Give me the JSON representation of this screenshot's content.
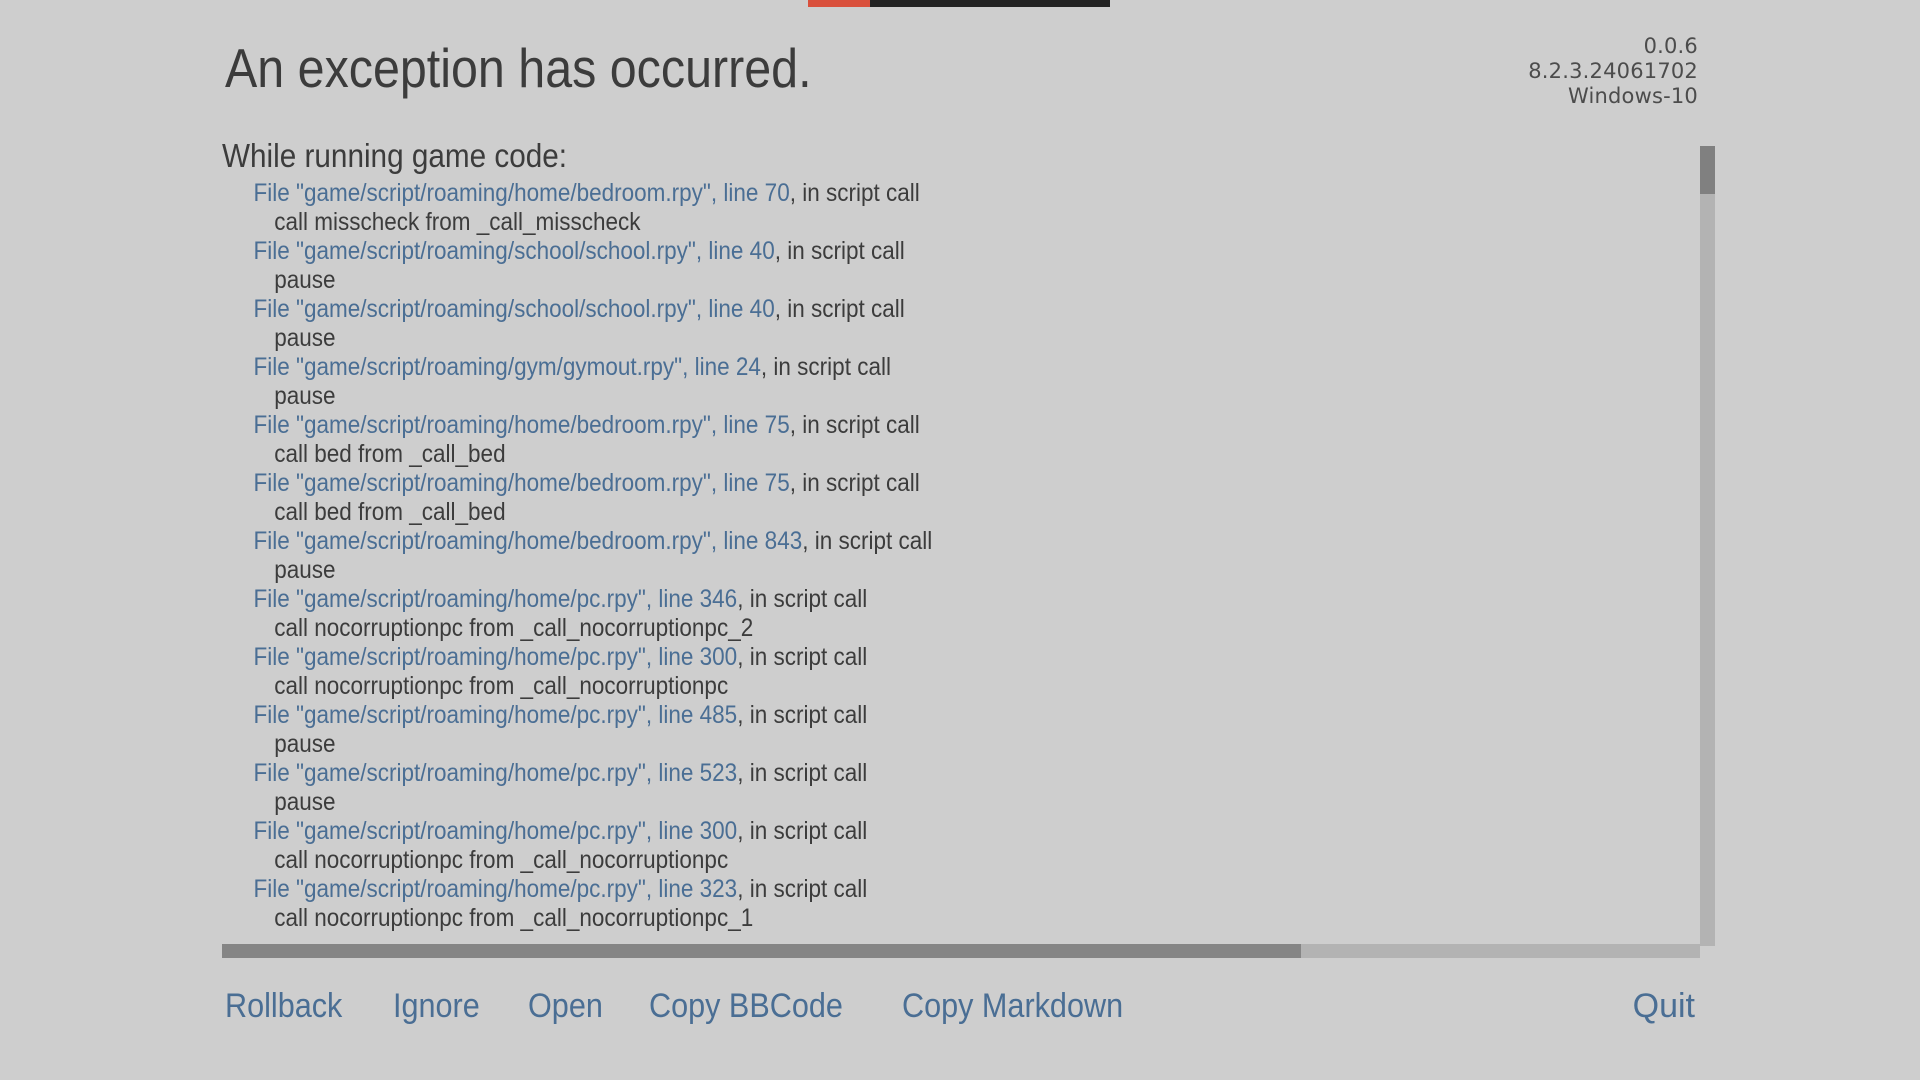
{
  "window": {
    "background_color": "#cecece",
    "link_color": "#4a6e94",
    "text_color": "#3c3c3c",
    "accent_color": "#d9503c"
  },
  "top_strip": {
    "segment_a_color": "#d9503c",
    "segment_b_color": "#232323"
  },
  "header": {
    "title": "An exception has occurred.",
    "version": {
      "game_version": "0.0.6",
      "engine_version": "8.2.3.24061702",
      "platform": "Windows-10"
    }
  },
  "traceback": {
    "heading": "While running game code:",
    "frames": [
      {
        "link": "File \"game/script/roaming/home/bedroom.rpy\", line 70",
        "suffix": ", in script call",
        "code": "call misscheck from _call_misscheck"
      },
      {
        "link": "File \"game/script/roaming/school/school.rpy\", line 40",
        "suffix": ", in script call",
        "code": "pause"
      },
      {
        "link": "File \"game/script/roaming/school/school.rpy\", line 40",
        "suffix": ", in script call",
        "code": "pause"
      },
      {
        "link": "File \"game/script/roaming/gym/gymout.rpy\", line 24",
        "suffix": ", in script call",
        "code": "pause"
      },
      {
        "link": "File \"game/script/roaming/home/bedroom.rpy\", line 75",
        "suffix": ", in script call",
        "code": "call bed from _call_bed"
      },
      {
        "link": "File \"game/script/roaming/home/bedroom.rpy\", line 75",
        "suffix": ", in script call",
        "code": "call bed from _call_bed"
      },
      {
        "link": "File \"game/script/roaming/home/bedroom.rpy\", line 843",
        "suffix": ", in script call",
        "code": "pause"
      },
      {
        "link": "File \"game/script/roaming/home/pc.rpy\", line 346",
        "suffix": ", in script call",
        "code": "call nocorruptionpc from _call_nocorruptionpc_2"
      },
      {
        "link": "File \"game/script/roaming/home/pc.rpy\", line 300",
        "suffix": ", in script call",
        "code": "call nocorruptionpc from _call_nocorruptionpc"
      },
      {
        "link": "File \"game/script/roaming/home/pc.rpy\", line 485",
        "suffix": ", in script call",
        "code": "pause"
      },
      {
        "link": "File \"game/script/roaming/home/pc.rpy\", line 523",
        "suffix": ", in script call",
        "code": "pause"
      },
      {
        "link": "File \"game/script/roaming/home/pc.rpy\", line 300",
        "suffix": ", in script call",
        "code": "call nocorruptionpc from _call_nocorruptionpc"
      },
      {
        "link": "File \"game/script/roaming/home/pc.rpy\", line 323",
        "suffix": ", in script call",
        "code": "call nocorruptionpc from _call_nocorruptionpc_1"
      }
    ]
  },
  "scrollbars": {
    "vertical_thumb_percent": 6,
    "horizontal_thumb_percent": 73
  },
  "buttons": {
    "rollback": "Rollback",
    "ignore": "Ignore",
    "open": "Open",
    "copy_bbcode": "Copy BBCode",
    "copy_markdown": "Copy Markdown",
    "quit": "Quit"
  }
}
